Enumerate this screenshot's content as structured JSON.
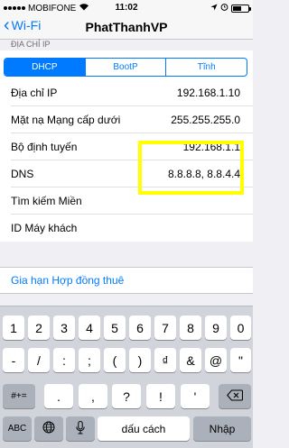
{
  "status_bar": {
    "carrier": "MOBIFONE",
    "time": "11:02",
    "battery_level": 0.55
  },
  "nav": {
    "back_label": "Wi-Fi",
    "title": "PhatThanhVP"
  },
  "section_header": "ĐỊA CHỈ IP",
  "segments": [
    {
      "label": "DHCP",
      "active": true
    },
    {
      "label": "BootP",
      "active": false
    },
    {
      "label": "Tĩnh",
      "active": false
    }
  ],
  "rows": [
    {
      "label": "Địa chỉ IP",
      "value": "192.168.1.10"
    },
    {
      "label": "Mặt nạ Mạng cấp dưới",
      "value": "255.255.255.0"
    },
    {
      "label": "Bộ định tuyến",
      "value": "192.168.1.1"
    },
    {
      "label": "DNS",
      "value": "8.8.8.8, 8.8.4.4"
    },
    {
      "label": "Tìm kiếm Miền",
      "value": ""
    },
    {
      "label": "ID Máy khách",
      "value": ""
    }
  ],
  "lease_label": "Gia hạn Hợp đồng thuê",
  "keyboard": {
    "row1": [
      "1",
      "2",
      "3",
      "4",
      "5",
      "6",
      "7",
      "8",
      "9",
      "0"
    ],
    "row2": [
      "-",
      "/",
      ":",
      ";",
      "(",
      ")",
      "₫",
      "&",
      "@",
      "\""
    ],
    "row3": [
      ".",
      ",",
      "?",
      "!",
      "'"
    ],
    "mode_switch": "#+=",
    "abc": "ABC",
    "space": "dấu cách",
    "return": "Nhập",
    "icons": [
      "globe-icon",
      "microphone-icon",
      "backspace-icon"
    ]
  }
}
